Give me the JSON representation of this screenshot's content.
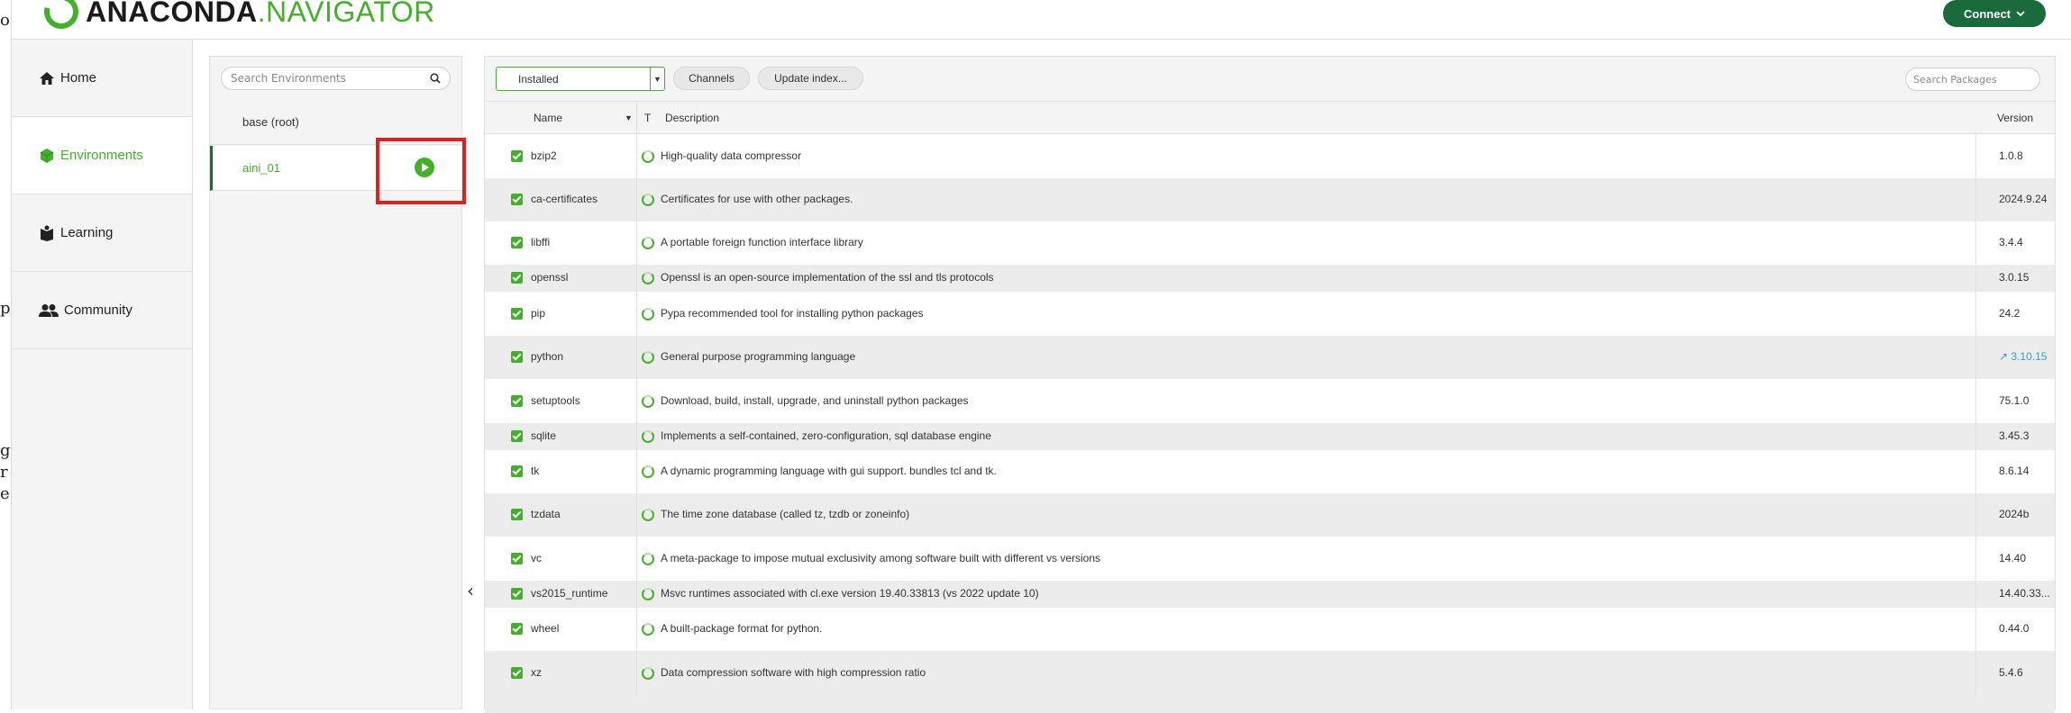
{
  "peek": {
    "chars": [
      "o",
      "p",
      "g",
      "r",
      "e"
    ]
  },
  "header": {
    "logo_main": "ANACONDA",
    "logo_dot": ".",
    "logo_sub": "NAVIGATOR",
    "connect_label": "Connect"
  },
  "sidebar": {
    "items": [
      {
        "label": "Home",
        "icon": "home-icon"
      },
      {
        "label": "Environments",
        "icon": "cube-icon"
      },
      {
        "label": "Learning",
        "icon": "book-icon"
      },
      {
        "label": "Community",
        "icon": "people-icon"
      }
    ]
  },
  "environments": {
    "search_placeholder": "Search Environments",
    "items": [
      {
        "name": "base (root)"
      },
      {
        "name": "aini_01"
      }
    ]
  },
  "packages": {
    "filter_value": "Installed",
    "channels_label": "Channels",
    "update_label": "Update index...",
    "search_placeholder": "Search Packages",
    "columns": {
      "name": "Name",
      "t": "T",
      "description": "Description",
      "version": "Version"
    },
    "rows": [
      {
        "name": "bzip2",
        "description": "High-quality data compressor",
        "version": "1.0.8"
      },
      {
        "name": "ca-certificates",
        "description": "Certificates for use with other packages.",
        "version": "2024.9.24"
      },
      {
        "name": "libffi",
        "description": "A portable foreign function interface library",
        "version": "3.4.4"
      },
      {
        "name": "openssl",
        "description": "Openssl is an open-source implementation of the ssl and tls protocols",
        "version": "3.0.15"
      },
      {
        "name": "pip",
        "description": "Pypa recommended tool for installing python packages",
        "version": "24.2"
      },
      {
        "name": "python",
        "description": "General purpose programming language",
        "version": "3.10.15",
        "upgradable": true
      },
      {
        "name": "setuptools",
        "description": "Download, build, install, upgrade, and uninstall python packages",
        "version": "75.1.0"
      },
      {
        "name": "sqlite",
        "description": "Implements a self-contained, zero-configuration, sql database engine",
        "version": "3.45.3"
      },
      {
        "name": "tk",
        "description": "A dynamic programming language with gui support. bundles tcl and tk.",
        "version": "8.6.14"
      },
      {
        "name": "tzdata",
        "description": "The time zone database (called tz, tzdb or zoneinfo)",
        "version": "2024b"
      },
      {
        "name": "vc",
        "description": "A meta-package to impose mutual exclusivity among software built with different vs versions",
        "version": "14.40"
      },
      {
        "name": "vs2015_runtime",
        "description": "Msvc runtimes associated with cl.exe version 19.40.33813 (vs 2022 update 10)",
        "version": "14.40.33..."
      },
      {
        "name": "wheel",
        "description": "A built-package format for python.",
        "version": "0.44.0"
      },
      {
        "name": "xz",
        "description": "Data compression software with high compression ratio",
        "version": "5.4.6"
      }
    ]
  },
  "colors": {
    "brand_green": "#43b02a",
    "dark_green": "#1a6a3c",
    "highlight_red": "#e02020",
    "upgrade_blue": "#2aa0d8"
  }
}
